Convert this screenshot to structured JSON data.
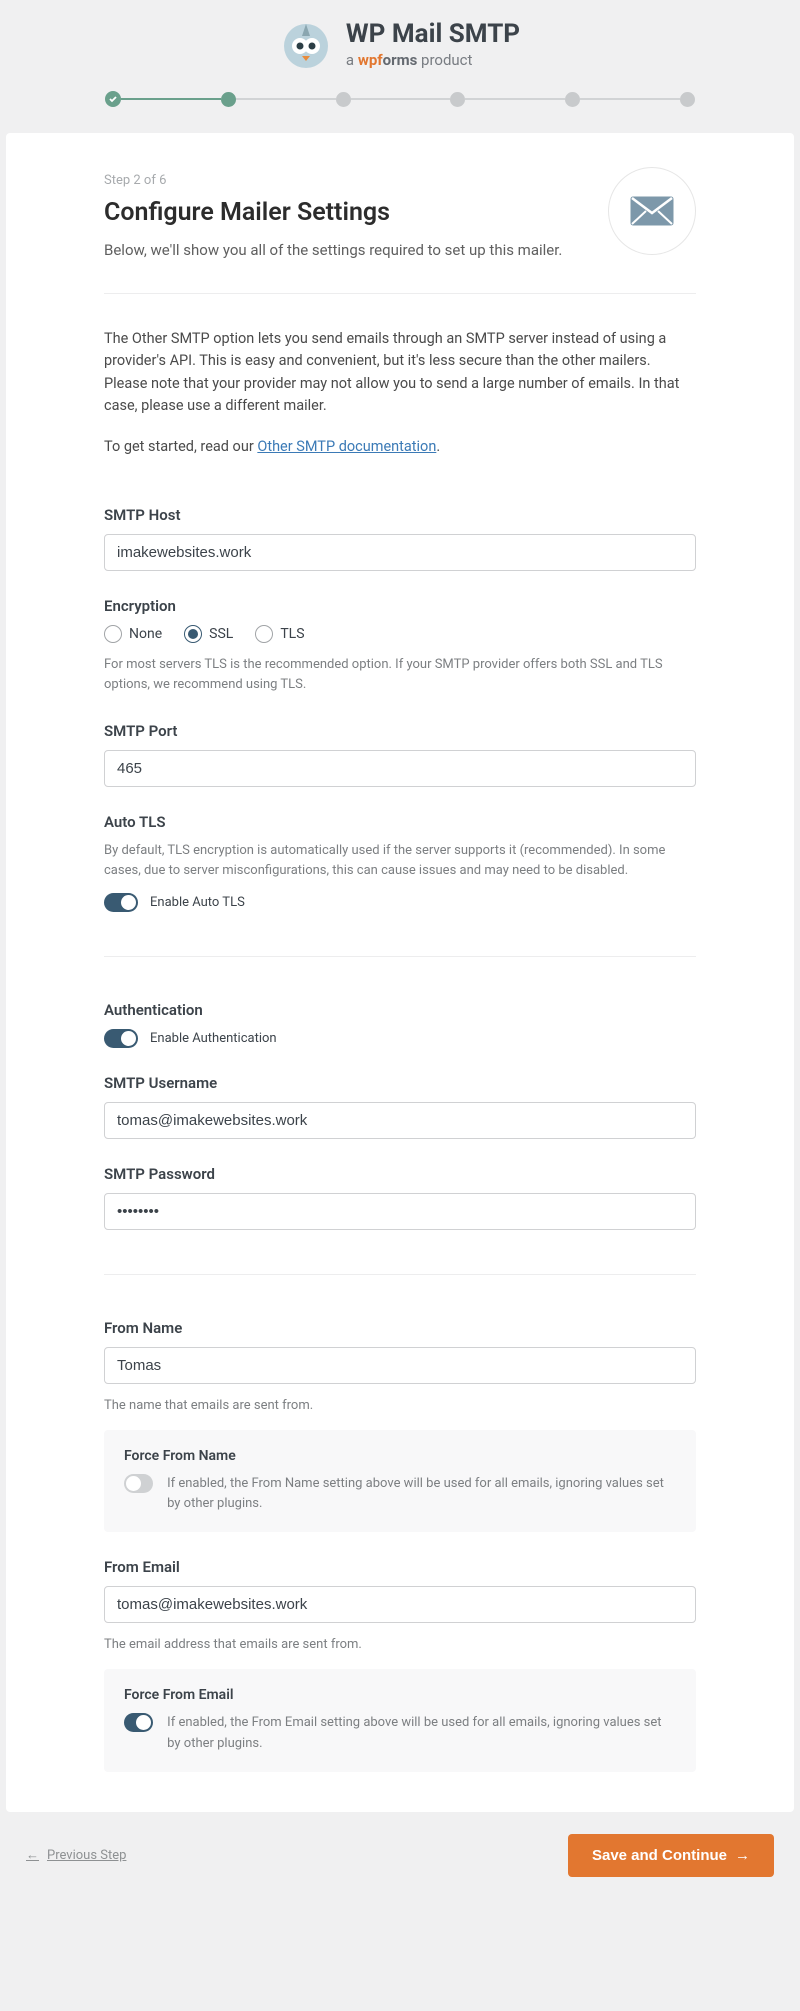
{
  "branding": {
    "title": "WP Mail SMTP",
    "subtitle_prefix": "a ",
    "subtitle_wpf": "wpf",
    "subtitle_orms": "orms",
    "subtitle_suffix": " product"
  },
  "progress": {
    "total_steps": 6,
    "current_step": 2
  },
  "page": {
    "step_label": "Step 2 of 6",
    "title": "Configure Mailer Settings",
    "subtitle": "Below, we'll show you all of the settings required to set up this mailer."
  },
  "intro": {
    "paragraph1": "The Other SMTP option lets you send emails through an SMTP server instead of using a provider's API. This is easy and convenient, but it's less secure than the other mailers. Please note that your provider may not allow you to send a large number of emails. In that case, please use a different mailer.",
    "paragraph2_prefix": "To get started, read our ",
    "paragraph2_link": "Other SMTP documentation",
    "paragraph2_suffix": "."
  },
  "fields": {
    "smtp_host": {
      "label": "SMTP Host",
      "value": "imakewebsites.work"
    },
    "encryption": {
      "label": "Encryption",
      "options": {
        "none": "None",
        "ssl": "SSL",
        "tls": "TLS"
      },
      "selected": "ssl",
      "help": "For most servers TLS is the recommended option. If your SMTP provider offers both SSL and TLS options, we recommend using TLS."
    },
    "smtp_port": {
      "label": "SMTP Port",
      "value": "465"
    },
    "auto_tls": {
      "label": "Auto TLS",
      "help": "By default, TLS encryption is automatically used if the server supports it (recommended). In some cases, due to server misconfigurations, this can cause issues and may need to be disabled.",
      "toggle_label": "Enable Auto TLS",
      "enabled": true
    },
    "authentication": {
      "label": "Authentication",
      "toggle_label": "Enable Authentication",
      "enabled": true
    },
    "smtp_username": {
      "label": "SMTP Username",
      "value": "tomas@imakewebsites.work"
    },
    "smtp_password": {
      "label": "SMTP Password",
      "value": "••••••••"
    },
    "from_name": {
      "label": "From Name",
      "value": "Tomas",
      "help": "The name that emails are sent from.",
      "force_title": "Force From Name",
      "force_desc": "If enabled, the From Name setting above will be used for all emails, ignoring values set by other plugins.",
      "force_enabled": false
    },
    "from_email": {
      "label": "From Email",
      "value": "tomas@imakewebsites.work",
      "help": "The email address that emails are sent from.",
      "force_title": "Force From Email",
      "force_desc": "If enabled, the From Email setting above will be used for all emails, ignoring values set by other plugins.",
      "force_enabled": true
    }
  },
  "footer": {
    "previous": "Previous Step",
    "save": "Save and Continue"
  }
}
